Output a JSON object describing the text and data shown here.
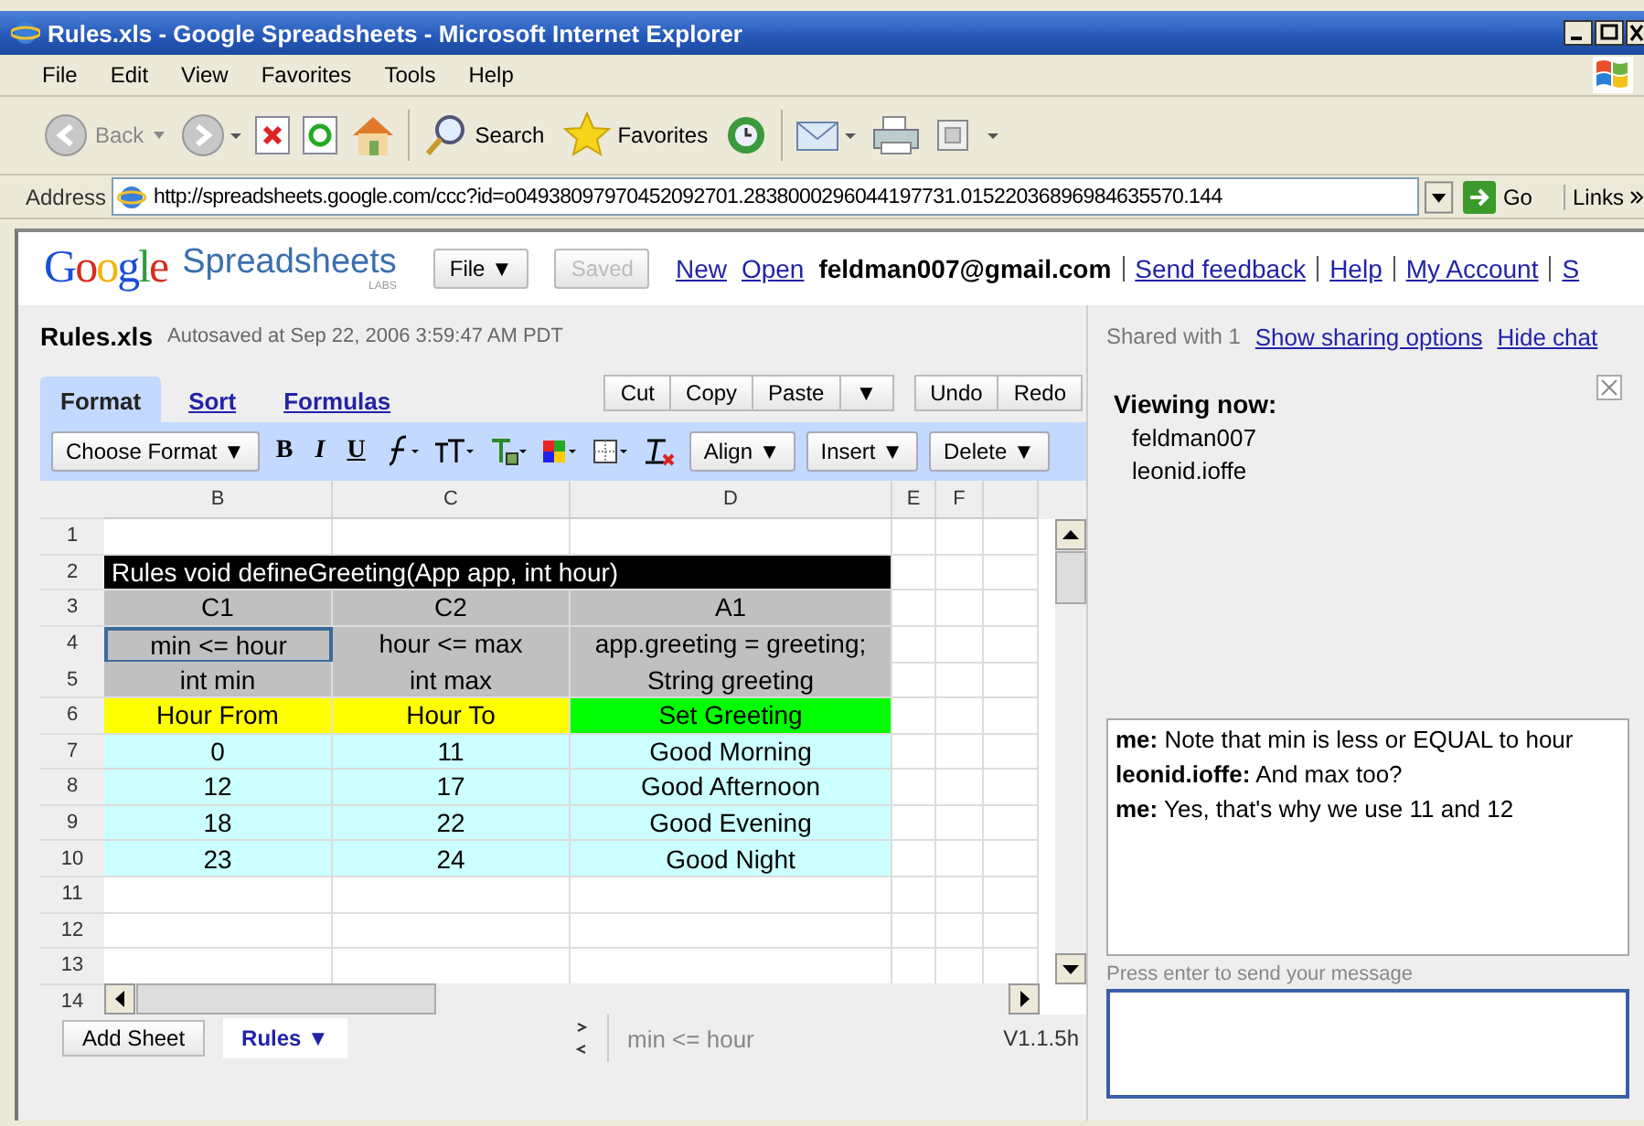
{
  "window": {
    "title": "Rules.xls - Google Spreadsheets - Microsoft Internet Explorer"
  },
  "menu": [
    "File",
    "Edit",
    "View",
    "Favorites",
    "Tools",
    "Help"
  ],
  "toolbar": {
    "back": "Back",
    "search": "Search",
    "favorites": "Favorites"
  },
  "address": {
    "label": "Address",
    "url": "http://spreadsheets.google.com/ccc?id=o04938097970452092701.2838000296044197731.01522036896984635570.144",
    "go": "Go",
    "links": "Links"
  },
  "header": {
    "logo": "Google",
    "product": "Spreadsheets",
    "badge": "LABS",
    "buttons": [
      {
        "label": "File ▼",
        "disabled": false
      },
      {
        "label": "Saved",
        "disabled": true
      }
    ],
    "links": [
      "New",
      "Open"
    ],
    "user": "feldman007@gmail.com",
    "account_links": [
      "Send feedback",
      "Help",
      "My Account",
      "S"
    ]
  },
  "document": {
    "name": "Rules.xls",
    "status": "Autosaved at Sep 22, 2006 3:59:47 AM PDT"
  },
  "sharing": {
    "text": "Shared with 1",
    "links": [
      "Show sharing options",
      "Hide chat"
    ]
  },
  "tabs": [
    {
      "label": "Format",
      "selected": true
    },
    {
      "label": "Sort",
      "selected": false
    },
    {
      "label": "Formulas",
      "selected": false
    }
  ],
  "edit_groups": [
    [
      "Cut",
      "Copy",
      "Paste",
      "▼"
    ],
    [
      "Undo",
      "Redo"
    ]
  ],
  "format_toolbar": {
    "choose": "Choose Format ▼",
    "style_buttons": [
      "B",
      "I",
      "U"
    ],
    "menus": [
      "Align ▼",
      "Insert ▼",
      "Delete ▼"
    ]
  },
  "sheet": {
    "columns": [
      "B",
      "C",
      "D",
      "E",
      "F"
    ],
    "rows": [
      {
        "number": "1"
      },
      {
        "number": "2",
        "kind": "merged",
        "cells": [
          {
            "text": "Rules void defineGreeting(App app, int hour)",
            "color": "#000000",
            "selected": false
          }
        ]
      },
      {
        "number": "3",
        "kind": "cells",
        "cells": [
          {
            "text": "C1",
            "color": "#c0c0c0",
            "selected": false
          },
          {
            "text": "C2",
            "color": "#c0c0c0",
            "selected": false
          },
          {
            "text": "A1",
            "color": "#c0c0c0",
            "selected": false
          }
        ]
      },
      {
        "number": "4",
        "kind": "cells",
        "cells": [
          {
            "text": "min <= hour",
            "color": "#c0c0c0",
            "selected": true
          },
          {
            "text": "hour <= max",
            "color": "#c0c0c0",
            "selected": false
          },
          {
            "text": "app.greeting = greeting;",
            "color": "#c0c0c0",
            "selected": false
          }
        ]
      },
      {
        "number": "5",
        "kind": "cells",
        "cells": [
          {
            "text": "int min",
            "color": "#c0c0c0",
            "selected": false
          },
          {
            "text": "int max",
            "color": "#c0c0c0",
            "selected": false
          },
          {
            "text": "String greeting",
            "color": "#c0c0c0",
            "selected": false
          }
        ]
      },
      {
        "number": "6",
        "kind": "cells",
        "cells": [
          {
            "text": "Hour From",
            "color": "#ffff00",
            "selected": false
          },
          {
            "text": "Hour To",
            "color": "#ffff00",
            "selected": false
          },
          {
            "text": "Set Greeting",
            "color": "#00ff00",
            "selected": false
          }
        ]
      },
      {
        "number": "7",
        "kind": "cells",
        "cells": [
          {
            "text": "0",
            "color": "#ccffff",
            "selected": false
          },
          {
            "text": "11",
            "color": "#ccffff",
            "selected": false
          },
          {
            "text": "Good Morning",
            "color": "#ccffff",
            "selected": false
          }
        ]
      },
      {
        "number": "8",
        "kind": "cells",
        "cells": [
          {
            "text": "12",
            "color": "#ccffff",
            "selected": false
          },
          {
            "text": "17",
            "color": "#ccffff",
            "selected": false
          },
          {
            "text": "Good Afternoon",
            "color": "#ccffff",
            "selected": false
          }
        ]
      },
      {
        "number": "9",
        "kind": "cells",
        "cells": [
          {
            "text": "18",
            "color": "#ccffff",
            "selected": false
          },
          {
            "text": "22",
            "color": "#ccffff",
            "selected": false
          },
          {
            "text": "Good Evening",
            "color": "#ccffff",
            "selected": false
          }
        ]
      },
      {
        "number": "10",
        "kind": "cells",
        "cells": [
          {
            "text": "23",
            "color": "#ccffff",
            "selected": false
          },
          {
            "text": "24",
            "color": "#ccffff",
            "selected": false
          },
          {
            "text": "Good Night",
            "color": "#ccffff",
            "selected": false
          }
        ]
      },
      {
        "number": "11"
      },
      {
        "number": "12"
      },
      {
        "number": "13"
      },
      {
        "number": "14"
      }
    ]
  },
  "sheet_bar": {
    "add": "Add Sheet",
    "sheets": [
      {
        "label": "Rules ▼",
        "selected": true
      }
    ],
    "formula": "min <= hour",
    "version": "V1.1.5h"
  },
  "chat": {
    "title": "Viewing now:",
    "viewers": [
      "feldman007",
      "leonid.ioffe"
    ],
    "messages": [
      {
        "sender": "me:",
        "text": "Note that min is less or EQUAL to hour"
      },
      {
        "sender": "leonid.ioffe:",
        "text": "And max too?"
      },
      {
        "sender": "me:",
        "text": "Yes, that's why we use 11 and 12"
      }
    ],
    "hint": "Press enter to send your message"
  }
}
